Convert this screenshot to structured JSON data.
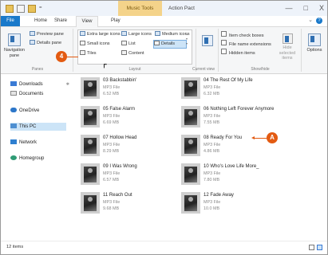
{
  "titlebar": {
    "context_tab": "Music Tools",
    "title": "Action Pact",
    "qat_dropdown": "=",
    "min": "—",
    "max": "□",
    "close": "X"
  },
  "tabs": [
    "File",
    "Home",
    "Share",
    "View",
    "Play"
  ],
  "ribbon": {
    "panes": {
      "label": "Panes",
      "nav_label": "Navigation pane",
      "preview": "Preview pane",
      "details": "Details pane"
    },
    "layout": {
      "label": "Layout",
      "items": [
        "Extra large icons",
        "Large icons",
        "Medium icons",
        "Small icons",
        "List",
        "Details",
        "Tiles",
        "Content"
      ],
      "selected": "Details"
    },
    "current_view": {
      "label": "Current view"
    },
    "showhide": {
      "label": "Show/hide",
      "item_check": "Item check boxes",
      "file_ext": "File name extensions",
      "hidden": "Hidden items",
      "hide_selected": "Hide selected items"
    },
    "options": "Options"
  },
  "callouts": {
    "step": "4",
    "marker": "A"
  },
  "nav": {
    "items": [
      "Downloads",
      "Documents",
      "OneDrive",
      "This PC",
      "Network",
      "Homegroup"
    ]
  },
  "files": [
    {
      "name": "03 Backstabbin'",
      "type": "MP3 File",
      "size": "6.52 MB"
    },
    {
      "name": "04 The Rest Of My Life",
      "type": "MP3 File",
      "size": "6.32 MB"
    },
    {
      "name": "05 False Alarm",
      "type": "MP3 File",
      "size": "6.69 MB"
    },
    {
      "name": "06 Nothing Left Forever Anymore",
      "type": "MP3 File",
      "size": "7.55 MB"
    },
    {
      "name": "07 Hollow Head",
      "type": "MP3 File",
      "size": "8.29 MB"
    },
    {
      "name": "08 Ready For You",
      "type": "MP3 File",
      "size": "4.86 MB"
    },
    {
      "name": "09 I Was Wrong",
      "type": "MP3 File",
      "size": "6.57 MB"
    },
    {
      "name": "10 Who's Love Life More_",
      "type": "MP3 File",
      "size": "7.80 MB"
    },
    {
      "name": "11 Reach Out",
      "type": "MP3 File",
      "size": "9.68 MB"
    },
    {
      "name": "12 Fade Away",
      "type": "MP3 File",
      "size": "10.0 MB"
    }
  ],
  "status": {
    "count": "12 items"
  }
}
